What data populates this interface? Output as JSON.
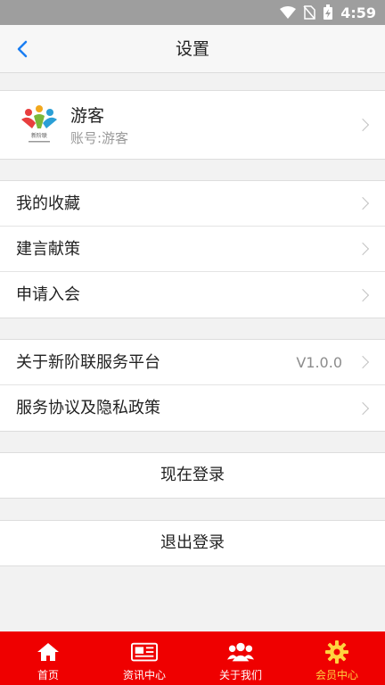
{
  "status_bar": {
    "time": "4:59"
  },
  "nav": {
    "title": "设置"
  },
  "profile": {
    "name": "游客",
    "account": "账号:游客",
    "logo_text": "新阶联"
  },
  "menu_group_1": [
    {
      "label": "我的收藏"
    },
    {
      "label": "建言献策"
    },
    {
      "label": "申请入会"
    }
  ],
  "menu_group_2": [
    {
      "label": "关于新阶联服务平台",
      "value": "V1.0.0"
    },
    {
      "label": "服务协议及隐私政策"
    }
  ],
  "actions": {
    "login": "现在登录",
    "logout": "退出登录"
  },
  "tabbar": [
    {
      "label": "首页",
      "icon": "home-icon"
    },
    {
      "label": "资讯中心",
      "icon": "newspaper-icon"
    },
    {
      "label": "关于我们",
      "icon": "group-icon"
    },
    {
      "label": "会员中心",
      "icon": "gear-icon",
      "active": true
    }
  ],
  "colors": {
    "tabbar_bg": "#ef0000",
    "tab_active": "#ffd23f",
    "back_arrow": "#1a7ef2"
  }
}
